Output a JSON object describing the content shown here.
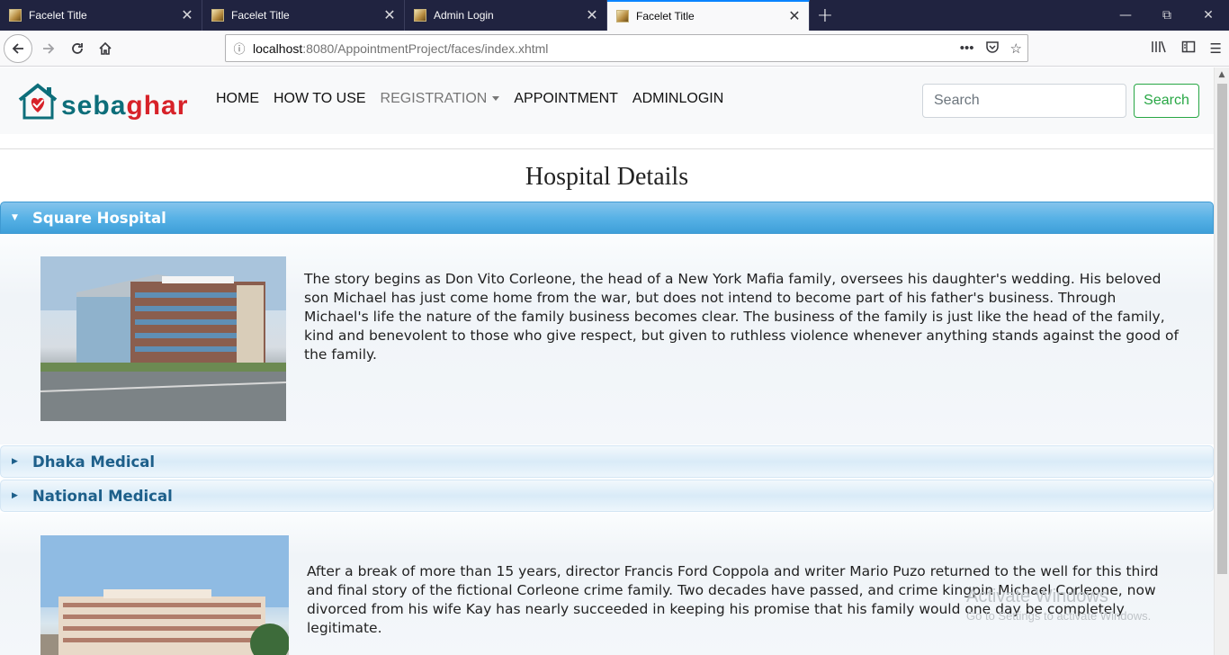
{
  "browser": {
    "tabs": [
      {
        "label": "Facelet Title",
        "active": false
      },
      {
        "label": "Facelet Title",
        "active": false
      },
      {
        "label": "Admin Login",
        "active": false
      },
      {
        "label": "Facelet Title",
        "active": true
      }
    ],
    "url_host": "localhost",
    "url_rest": ":8080/AppointmentProject/faces/index.xhtml"
  },
  "site": {
    "logo_part1": "seba",
    "logo_part2": "ghar",
    "menu": {
      "home": "HOME",
      "how_to_use": "HOW TO USE",
      "registration": "REGISTRATION",
      "appointment": "APPOINTMENT",
      "adminlogin": "ADMINLOGIN"
    },
    "search": {
      "placeholder": "Search",
      "button": "Search"
    },
    "colors": {
      "brand_teal": "#0d6e7a",
      "brand_red": "#d72229",
      "search_green": "#28a745",
      "accordion_blue": "#58b2e6"
    }
  },
  "page": {
    "title": "Hospital Details",
    "hospitals": [
      {
        "name": "Square Hospital",
        "expanded": true,
        "description": "The story begins as Don Vito Corleone, the head of a New York Mafia family, oversees his daughter's wedding. His beloved son Michael has just come home from the war, but does not intend to become part of his father's business. Through Michael's life the nature of the family business becomes clear. The business of the family is just like the head of the family, kind and benevolent to those who give respect, but given to ruthless violence whenever anything stands against the good of the family."
      },
      {
        "name": "Dhaka Medical",
        "expanded": false
      },
      {
        "name": "National Medical",
        "expanded": false,
        "description": "After a break of more than 15 years, director Francis Ford Coppola and writer Mario Puzo returned to the well for this third and final story of the fictional Corleone crime family. Two decades have passed, and crime kingpin Michael Corleone, now divorced from his wife Kay has nearly succeeded in keeping his promise that his family would one day be completely legitimate."
      }
    ]
  },
  "overlay": {
    "watermark_line1": "Activate Windows",
    "watermark_line2": "Go to Settings to activate Windows."
  }
}
